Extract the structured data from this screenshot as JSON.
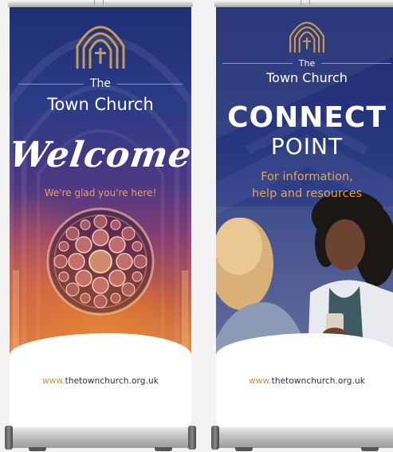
{
  "banner_left": {
    "the_label": "The",
    "church_name": "Town Church",
    "headline": "Welcome",
    "tagline": "We're glad you're here!",
    "url_www": "www.",
    "url_domain": "thetownchurch.org.uk"
  },
  "banner_right": {
    "the_label": "The",
    "church_name": "Town Church",
    "headline_1": "CONNECT",
    "headline_2": "POINT",
    "info_line_1": "For information,",
    "info_line_2": "help and resources",
    "url_www": "www.",
    "url_domain": "thetownchurch.org.uk"
  },
  "colors": {
    "navy": "#1f2b70",
    "gold": "#c89a55",
    "orange_text": "#e3a45e"
  }
}
